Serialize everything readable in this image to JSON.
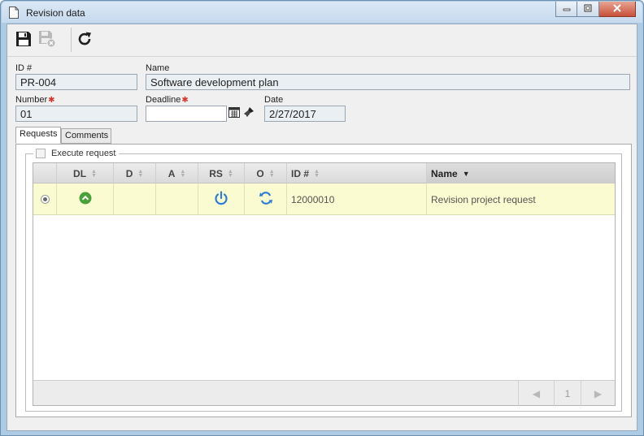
{
  "window": {
    "title": "Revision data",
    "icon": "document-icon",
    "controls": [
      "minimize-icon",
      "restore-icon",
      "close-icon"
    ]
  },
  "toolbar": {
    "buttons": [
      {
        "name": "save",
        "icon": "floppy-disk-icon",
        "enabled": true
      },
      {
        "name": "save-and-close",
        "icon": "floppy-disk-close-icon",
        "enabled": false
      },
      {
        "name": "refresh",
        "icon": "refresh-icon",
        "enabled": true
      }
    ]
  },
  "form": {
    "id_label": "ID #",
    "id_value": "PR-004",
    "name_label": "Name",
    "name_value": "Software development plan",
    "number_label": "Number",
    "number_value": "01",
    "deadline_label": "Deadline",
    "deadline_value": "",
    "date_label": "Date",
    "date_value": "2/27/2017",
    "required_marker_icon": "required-asterisk-icon"
  },
  "tabs": [
    {
      "label": "Requests",
      "active": true
    },
    {
      "label": "Comments",
      "active": false
    }
  ],
  "requests": {
    "execute_request_label": "Execute request",
    "execute_request_checked": false,
    "columns": [
      {
        "label": "",
        "key": "select"
      },
      {
        "label": "DL",
        "sort": "none"
      },
      {
        "label": "D",
        "sort": "none"
      },
      {
        "label": "A",
        "sort": "none"
      },
      {
        "label": "RS",
        "sort": "none"
      },
      {
        "label": "O",
        "sort": "none"
      },
      {
        "label": "ID #",
        "sort": "none"
      },
      {
        "label": "Name",
        "sort": "descending"
      }
    ],
    "rows": [
      {
        "selected": true,
        "dl_icon": "green-circle-chevron-up-icon",
        "d": "",
        "a": "",
        "rs_icon": "power-icon",
        "o_icon": "sync-icon",
        "id": "12000010",
        "name": "Revision project request"
      }
    ],
    "pager": {
      "page": "1",
      "prev_icon": "prev-page-icon",
      "next_icon": "next-page-icon"
    }
  },
  "colors": {
    "row_highlight": "#fbfbd2",
    "status_green": "#4aa03a",
    "icon_blue": "#2f7fd1",
    "required_red": "#d9342b"
  }
}
